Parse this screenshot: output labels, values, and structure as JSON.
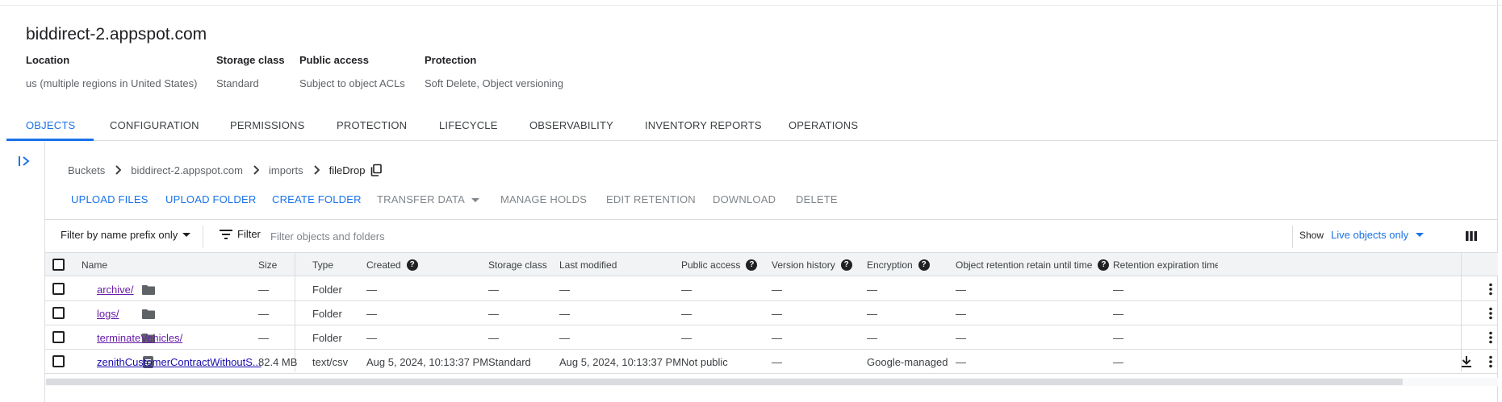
{
  "bucket": {
    "title": "biddirect-2.appspot.com",
    "meta": [
      {
        "label": "Location",
        "value": "us (multiple regions in United States)"
      },
      {
        "label": "Storage class",
        "value": "Standard"
      },
      {
        "label": "Public access",
        "value": "Subject to object ACLs"
      },
      {
        "label": "Protection",
        "value": "Soft Delete, Object versioning"
      }
    ]
  },
  "tabs": [
    "OBJECTS",
    "CONFIGURATION",
    "PERMISSIONS",
    "PROTECTION",
    "LIFECYCLE",
    "OBSERVABILITY",
    "INVENTORY REPORTS",
    "OPERATIONS"
  ],
  "active_tab": "OBJECTS",
  "breadcrumb": [
    "Buckets",
    "biddirect-2.appspot.com",
    "imports",
    "fileDrop"
  ],
  "actions": {
    "upload_files": "UPLOAD FILES",
    "upload_folder": "UPLOAD FOLDER",
    "create_folder": "CREATE FOLDER",
    "transfer_data": "TRANSFER DATA",
    "manage_holds": "MANAGE HOLDS",
    "edit_retention": "EDIT RETENTION",
    "download": "DOWNLOAD",
    "delete": "DELETE"
  },
  "filter": {
    "mode": "Filter by name prefix only",
    "button": "Filter",
    "placeholder": "Filter objects and folders",
    "show_label": "Show",
    "show_value": "Live objects only"
  },
  "table": {
    "headers": {
      "name": "Name",
      "size": "Size",
      "type": "Type",
      "created": "Created",
      "storage_class": "Storage class",
      "last_modified": "Last modified",
      "public_access": "Public access",
      "version_history": "Version history",
      "encryption": "Encryption",
      "retain_until": "Object retention retain until time",
      "retention_expiration": "Retention expiration time"
    },
    "rows": [
      {
        "kind": "folder",
        "name": "archive/",
        "size": "—",
        "type": "Folder",
        "created": "—",
        "storage_class": "—",
        "last_modified": "—",
        "public_access": "—",
        "version_history": "—",
        "encryption": "—",
        "retain_until": "—",
        "retention_expiration": "—"
      },
      {
        "kind": "folder",
        "name": "logs/",
        "size": "—",
        "type": "Folder",
        "created": "—",
        "storage_class": "—",
        "last_modified": "—",
        "public_access": "—",
        "version_history": "—",
        "encryption": "—",
        "retain_until": "—",
        "retention_expiration": "—"
      },
      {
        "kind": "folder",
        "name": "terminateVehicles/",
        "size": "—",
        "type": "Folder",
        "created": "—",
        "storage_class": "—",
        "last_modified": "—",
        "public_access": "—",
        "version_history": "—",
        "encryption": "—",
        "retain_until": "—",
        "retention_expiration": "—"
      },
      {
        "kind": "file",
        "name": "zenithCustomerContractWithoutS...",
        "size": "82.4 MB",
        "type": "text/csv",
        "created": "Aug 5, 2024, 10:13:37 PM",
        "storage_class": "Standard",
        "last_modified": "Aug 5, 2024, 10:13:37 PM",
        "public_access": "Not public",
        "version_history": "—",
        "encryption": "Google-managed",
        "retain_until": "—",
        "retention_expiration": "—"
      }
    ]
  },
  "colors": {
    "accent": "#1a73e8",
    "visited_link": "#681da8",
    "header_bg": "#f1f3f4",
    "border": "#dadce0"
  }
}
